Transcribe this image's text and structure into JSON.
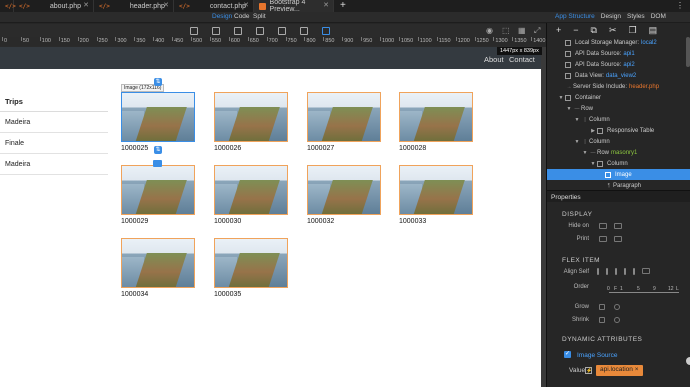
{
  "tabs": [
    {
      "label": "about.php"
    },
    {
      "label": "header.php"
    },
    {
      "label": "contact.php"
    },
    {
      "label": "Bootstrap 4 Preview..."
    }
  ],
  "tab_more": "⋮",
  "modes": {
    "design": "Design",
    "code": "Code",
    "split": "Split"
  },
  "panel_tabs": {
    "app_structure": "App Structure",
    "design": "Design",
    "styles": "Styles",
    "dom": "DOM"
  },
  "ruler": {
    "labels": [
      "0",
      "50",
      "100",
      "150",
      "200",
      "250",
      "300",
      "350",
      "400",
      "450",
      "500",
      "550",
      "600",
      "650",
      "700",
      "750",
      "800",
      "850",
      "900",
      "950",
      "1000",
      "1050",
      "1100",
      "1150",
      "1200",
      "1250",
      "1300",
      "1350",
      "1400"
    ]
  },
  "dims_badge": "1447px x 839px",
  "site_nav": {
    "about": "About",
    "contact": "Contact"
  },
  "sidebar": {
    "heading": "Trips",
    "items": [
      "Madeira",
      "Finale",
      "Madeira"
    ]
  },
  "gallery": {
    "selection_label": "Image (172x116)",
    "items": [
      "1000025",
      "1000026",
      "1000027",
      "1000028",
      "1000029",
      "1000030",
      "1000032",
      "1000033",
      "1000034",
      "1000035"
    ]
  },
  "tree": {
    "rows": [
      {
        "label": "Local Storage Manager:",
        "value": "local2"
      },
      {
        "label": "API Data Source:",
        "value": "api1"
      },
      {
        "label": "API Data Source:",
        "value": "api2"
      },
      {
        "label": "Data View:",
        "value": "data_view2"
      },
      {
        "label": "Server Side Include:",
        "value": "header.php"
      },
      {
        "label": "Container",
        "value": ""
      },
      {
        "label": "Row",
        "value": ""
      },
      {
        "label": "Column",
        "value": ""
      },
      {
        "label": "Responsive Table",
        "value": ""
      },
      {
        "label": "Column",
        "value": ""
      },
      {
        "label": "Row",
        "value": "masonry1"
      },
      {
        "label": "Column",
        "value": ""
      },
      {
        "label": "Image",
        "value": ""
      },
      {
        "label": "Paragraph",
        "value": ""
      }
    ]
  },
  "properties": {
    "header": "Properties",
    "display_title": "DISPLAY",
    "hide_on": "Hide on",
    "print": "Print",
    "flex_title": "FLEX ITEM",
    "align_self": "Align Self",
    "order": "Order",
    "order_marks": [
      "0",
      "F",
      "1",
      "5",
      "9",
      "12",
      "L"
    ],
    "grow": "Grow",
    "shrink": "Shrink",
    "dynamic_title": "DYNAMIC ATTRIBUTES",
    "image_source": "Image Source",
    "value_label": "Value",
    "value_chip": "api.location",
    "value_chip_close": "×"
  },
  "colors": {
    "accent": "#3a8ee6",
    "orange": "#e8762d",
    "panel_bg": "#262626"
  }
}
